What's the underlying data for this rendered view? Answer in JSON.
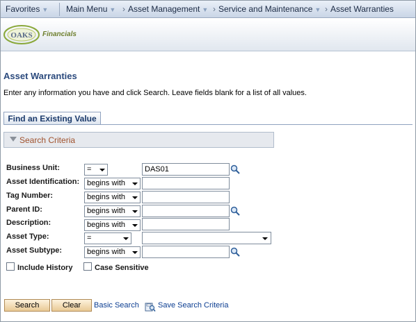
{
  "nav": {
    "favorites": "Favorites",
    "main_menu": "Main Menu",
    "crumb1": "Asset Management",
    "crumb2": "Service and Maintenance",
    "crumb3": "Asset Warranties"
  },
  "header": {
    "logo_word": "OAKS",
    "logo_sub": "Financials"
  },
  "page": {
    "title": "Asset Warranties",
    "instructions": "Enter any information you have and click Search. Leave fields blank for a list of all values."
  },
  "tab": {
    "label": "Find an Existing Value"
  },
  "criteria": {
    "label": "Search Criteria"
  },
  "form": {
    "business_unit": {
      "label": "Business Unit:",
      "operator": "=",
      "value": "DAS01"
    },
    "asset_id": {
      "label": "Asset Identification:",
      "operator": "begins with",
      "value": ""
    },
    "tag_number": {
      "label": "Tag Number:",
      "operator": "begins with",
      "value": ""
    },
    "parent_id": {
      "label": "Parent ID:",
      "operator": "begins with",
      "value": ""
    },
    "description": {
      "label": "Description:",
      "operator": "begins with",
      "value": ""
    },
    "asset_type": {
      "label": "Asset Type:",
      "operator": "=",
      "value": ""
    },
    "asset_subtype": {
      "label": "Asset Subtype:",
      "operator": "begins with",
      "value": ""
    }
  },
  "options": {
    "include_history": "Include History",
    "case_sensitive": "Case Sensitive"
  },
  "actions": {
    "search": "Search",
    "clear": "Clear",
    "basic_search": "Basic Search",
    "save_search": "Save Search Criteria"
  },
  "icons": {
    "lookup": "magnifier-icon",
    "save": "save-search-icon",
    "dropdown": "chevron-down-icon"
  },
  "colors": {
    "title": "#2b4a7d",
    "criteria_label": "#a0522d",
    "link": "#0b3d91",
    "button_bg": "#e9c995"
  }
}
